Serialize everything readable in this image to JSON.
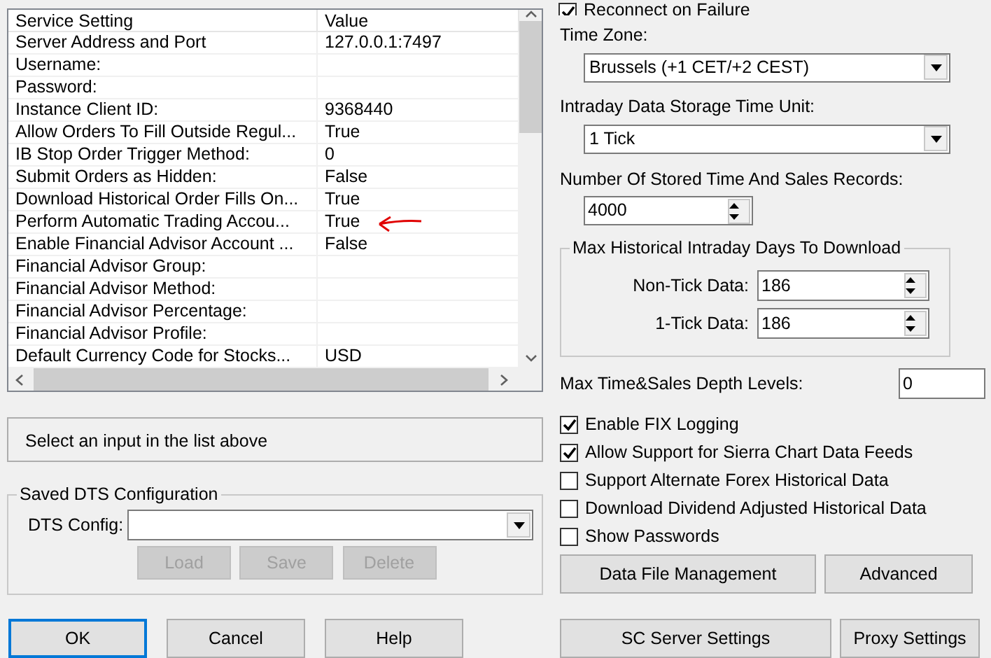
{
  "settings_table": {
    "columns": [
      "Service Setting",
      "Value"
    ],
    "rows": [
      {
        "setting": "Server Address and Port",
        "value": "127.0.0.1:7497",
        "arrow_marked": false
      },
      {
        "setting": "Username:",
        "arrow_marked": false
      },
      {
        "setting": "Password:",
        "arrow_marked": false
      },
      {
        "setting": "Instance Client ID:",
        "value": "9368440",
        "arrow_marked": false
      },
      {
        "setting": "Allow Orders To Fill Outside Regul...",
        "value": "True",
        "arrow_marked": false
      },
      {
        "setting": "IB Stop Order Trigger Method:",
        "value": "0",
        "arrow_marked": false
      },
      {
        "setting": "Submit Orders as Hidden:",
        "value": "False",
        "arrow_marked": false
      },
      {
        "setting": "Download Historical Order Fills On...",
        "value": "True",
        "arrow_marked": false
      },
      {
        "setting": "Perform Automatic Trading Accou...",
        "value": "True",
        "arrow_marked": true
      },
      {
        "setting": "Enable Financial Advisor Account ...",
        "value": "False",
        "arrow_marked": false
      },
      {
        "setting": "Financial Advisor Group:",
        "arrow_marked": false
      },
      {
        "setting": "Financial Advisor Method:",
        "arrow_marked": false
      },
      {
        "setting": "Financial Advisor Percentage:",
        "arrow_marked": false
      },
      {
        "setting": "Financial Advisor Profile:",
        "arrow_marked": false
      },
      {
        "setting": "Default Currency Code for Stocks...",
        "value": "USD",
        "arrow_marked": false
      }
    ]
  },
  "description": "Select an input in the list above",
  "saved_config": {
    "title": "Saved DTS Configuration",
    "label": "DTS Config:",
    "buttons": [
      {
        "label": "Load",
        "disabled": true
      },
      {
        "label": "Save",
        "disabled": true
      },
      {
        "label": "Delete",
        "disabled": true
      }
    ]
  },
  "dialog_buttons": [
    {
      "label": "OK",
      "default": true
    },
    {
      "label": "Cancel",
      "default": false
    },
    {
      "label": "Help",
      "default": false
    }
  ],
  "reconnect": {
    "label": "Reconnect on Failure",
    "checked": true
  },
  "time_zone": {
    "label": "Time Zone:",
    "value": "Brussels (+1 CET/+2 CEST)"
  },
  "storage_unit": {
    "label": "Intraday Data Storage Time Unit:",
    "value": "1 Tick"
  },
  "stored_records": {
    "label": "Number Of Stored Time And Sales Records:",
    "value": "4000"
  },
  "max_days": {
    "title": "Max Historical Intraday Days To Download",
    "fields": [
      {
        "label": "Non-Tick Data:",
        "value": "186"
      },
      {
        "label": "1-Tick Data:",
        "value": "186"
      }
    ]
  },
  "depth_levels": {
    "label": "Max Time&Sales Depth Levels:",
    "value": "0"
  },
  "options": [
    {
      "label": "Enable FIX Logging",
      "checked": true
    },
    {
      "label": "Allow Support for Sierra Chart Data Feeds",
      "checked": true
    },
    {
      "label": "Support Alternate Forex Historical Data",
      "checked": false
    },
    {
      "label": "Download Dividend Adjusted Historical Data",
      "checked": false
    },
    {
      "label": "Show Passwords",
      "checked": false
    }
  ],
  "buttons": [
    {
      "label": "Data File Management"
    },
    {
      "label": "Advanced"
    }
  ],
  "bottom_buttons": [
    {
      "label": "SC Server Settings"
    },
    {
      "label": "Proxy Settings"
    }
  ]
}
